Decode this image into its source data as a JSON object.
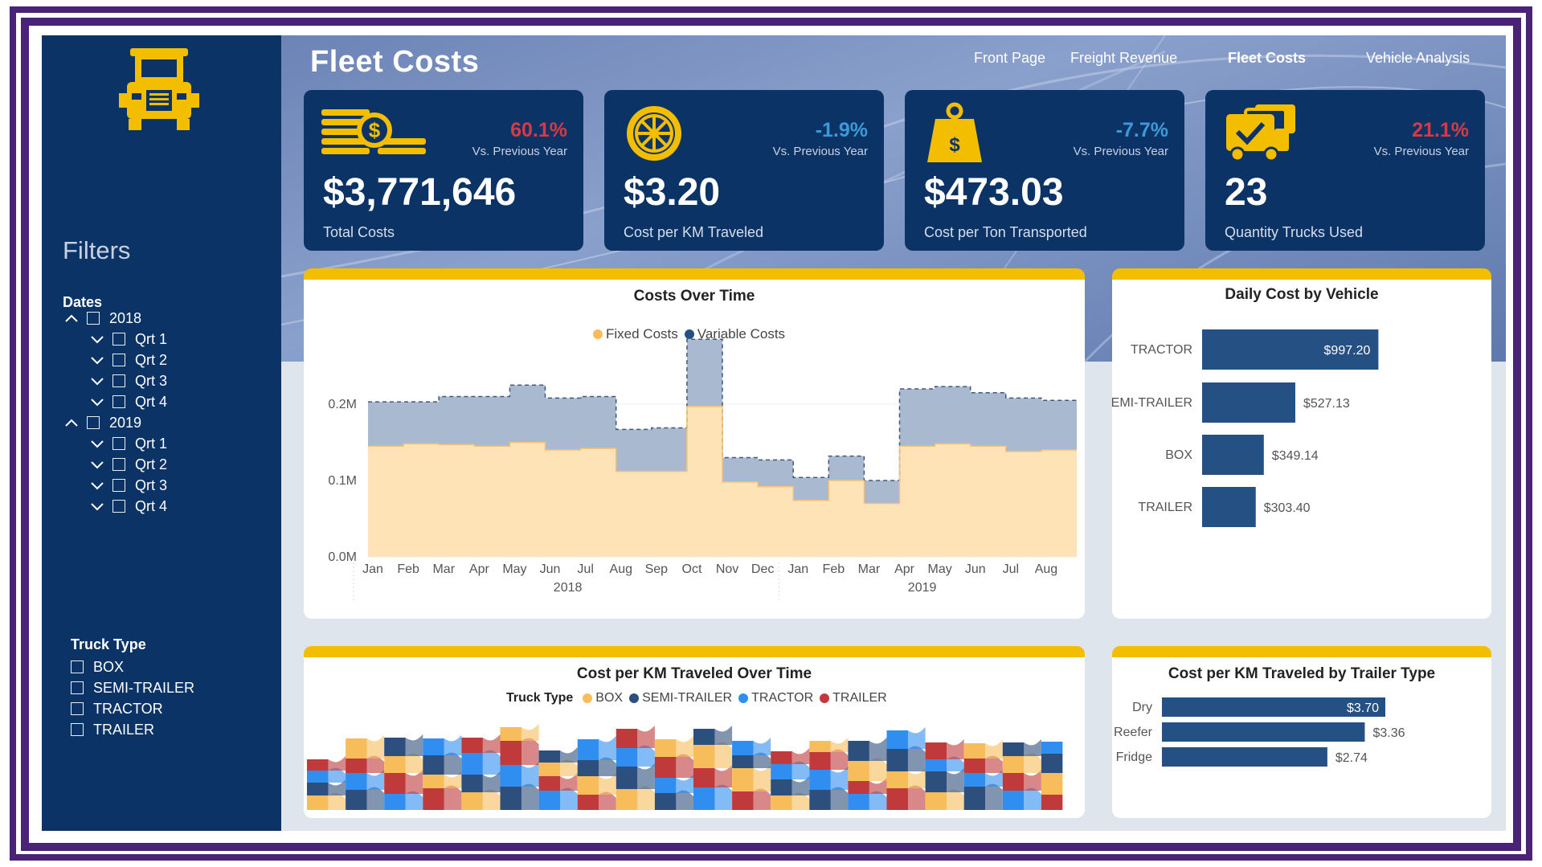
{
  "app": {
    "title": "Fleet Costs"
  },
  "nav": {
    "items": [
      "Front Page",
      "Freight Revenue",
      "Fleet Costs",
      "Vehicle Analysis"
    ],
    "active": "Fleet Costs"
  },
  "colors": {
    "navy": "#0c3366",
    "gold": "#f3bd00",
    "frame": "#4a2379",
    "red": "#d63a45",
    "teal": "#3d9ad9",
    "fixed": "#fde3b6",
    "variable": "#a8b9d0",
    "bar": "#245083"
  },
  "sidebar": {
    "logo_icon": "truck-icon",
    "filters_title": "Filters",
    "dates_title": "Dates",
    "years": [
      {
        "label": "2018",
        "quarters": [
          "Qrt 1",
          "Qrt 2",
          "Qrt 3",
          "Qrt 4"
        ]
      },
      {
        "label": "2019",
        "quarters": [
          "Qrt 1",
          "Qrt 2",
          "Qrt 3",
          "Qrt 4"
        ]
      }
    ],
    "truck_type_title": "Truck Type",
    "truck_types": [
      "BOX",
      "SEMI-TRAILER",
      "TRACTOR",
      "TRAILER"
    ]
  },
  "kpis": [
    {
      "icon": "coins-dollar-icon",
      "delta": "60.1%",
      "delta_color": "#d63a45",
      "vs": "Vs. Previous Year",
      "value": "$3,771,646",
      "label": "Total Costs"
    },
    {
      "icon": "wheel-icon",
      "delta": "-1.9%",
      "delta_color": "#3d9ad9",
      "vs": "Vs. Previous Year",
      "value": "$3.20",
      "label": "Cost per KM Traveled"
    },
    {
      "icon": "weight-dollar-icon",
      "delta": "-7.7%",
      "delta_color": "#3d9ad9",
      "vs": "Vs. Previous Year",
      "value": "$473.03",
      "label": "Cost per Ton Transported"
    },
    {
      "icon": "trucks-check-icon",
      "delta": "21.1%",
      "delta_color": "#d63a45",
      "vs": "Vs. Previous Year",
      "value": "23",
      "label": "Quantity Trucks Used"
    }
  ],
  "costs_over_time": {
    "title": "Costs Over Time",
    "legend": [
      "Fixed Costs",
      "Variable Costs"
    ]
  },
  "daily_cost": {
    "title": "Daily Cost by Vehicle"
  },
  "cost_km_time": {
    "title": "Cost per KM Traveled Over Time",
    "legend_title": "Truck Type",
    "legend": [
      "BOX",
      "SEMI-TRAILER",
      "TRACTOR",
      "TRAILER"
    ],
    "series_colors": [
      "#f7bd5a",
      "#2d4f7d",
      "#2f8ef0",
      "#c0393b"
    ]
  },
  "cost_km_trailer": {
    "title": "Cost per KM Traveled by Trailer Type"
  },
  "chart_data": [
    {
      "type": "area",
      "title": "Costs Over Time",
      "x": [
        "Jan",
        "Feb",
        "Mar",
        "Apr",
        "May",
        "Jun",
        "Jul",
        "Aug",
        "Sep",
        "Oct",
        "Nov",
        "Dec",
        "Jan",
        "Feb",
        "Mar",
        "Apr",
        "May",
        "Jun",
        "Jul",
        "Aug"
      ],
      "x_groups": [
        {
          "label": "2018",
          "count": 12
        },
        {
          "label": "2019",
          "count": 8
        }
      ],
      "series": [
        {
          "name": "Fixed Costs",
          "values": [
            0.145,
            0.148,
            0.147,
            0.145,
            0.15,
            0.14,
            0.142,
            0.112,
            0.112,
            0.197,
            0.098,
            0.092,
            0.074,
            0.1,
            0.07,
            0.145,
            0.148,
            0.145,
            0.138,
            0.14
          ]
        },
        {
          "name": "Variable Costs",
          "values": [
            0.058,
            0.055,
            0.063,
            0.065,
            0.075,
            0.068,
            0.068,
            0.055,
            0.057,
            0.088,
            0.032,
            0.035,
            0.03,
            0.032,
            0.03,
            0.075,
            0.075,
            0.07,
            0.07,
            0.065
          ]
        }
      ],
      "y_ticks": [
        "0.0M",
        "0.1M",
        "0.2M"
      ],
      "ylim": [
        0,
        0.3
      ],
      "legend_position": "top"
    },
    {
      "type": "bar",
      "orientation": "horizontal",
      "title": "Daily Cost by Vehicle",
      "categories": [
        "TRACTOR",
        "SEMI-TRAILER",
        "BOX",
        "TRAILER"
      ],
      "values": [
        997.2,
        527.13,
        349.14,
        303.4
      ],
      "labels": [
        "$997.20",
        "$527.13",
        "$349.14",
        "$303.40"
      ]
    },
    {
      "type": "area",
      "subtype": "ribbon",
      "title": "Cost per KM Traveled Over Time",
      "series_names": [
        "BOX",
        "SEMI-TRAILER",
        "TRACTOR",
        "TRAILER"
      ]
    },
    {
      "type": "bar",
      "orientation": "horizontal",
      "title": "Cost per KM Traveled by Trailer Type",
      "categories": [
        "Dry",
        "Reefer",
        "Fridge"
      ],
      "values": [
        3.7,
        3.36,
        2.74
      ],
      "labels": [
        "$3.70",
        "$3.36",
        "$2.74"
      ]
    }
  ]
}
